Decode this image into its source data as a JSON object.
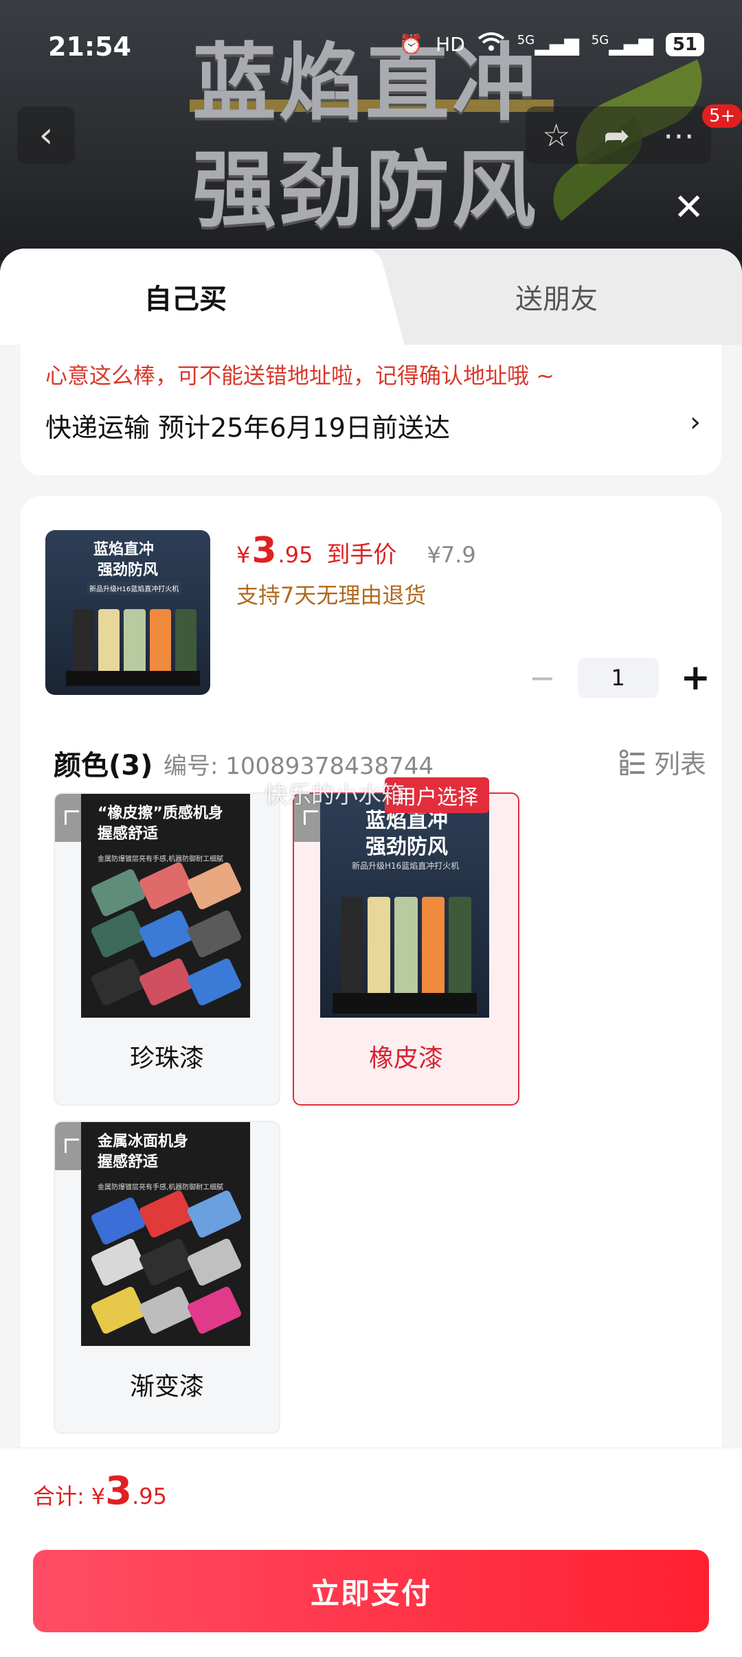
{
  "status_bar": {
    "time": "21:54",
    "hd": "HD",
    "net1": "5G",
    "net2": "5G",
    "battery": "51"
  },
  "banner": {
    "line1": "蓝焰直冲",
    "line2": "强劲防风",
    "badge_count": "5+"
  },
  "icons": {
    "back": "chevron-left-icon",
    "favorite": "star-icon",
    "share": "share-icon",
    "more": "more-icon",
    "close": "close-icon"
  },
  "tabs": {
    "self": "自己买",
    "friend": "送朋友"
  },
  "address": {
    "hint": "心意这么棒，可不能送错地址啦，记得确认地址哦 ~",
    "delivery": "快递运输 预计25年6月19日前送达",
    "arrow": "›"
  },
  "product": {
    "thumb_title1": "蓝焰直冲",
    "thumb_title2": "强劲防风",
    "thumb_sub": "新品升级H16蓝焰直冲打火机",
    "price_currency": "¥",
    "price_int": "3",
    "price_dec": ".95",
    "price_label": "到手价",
    "original_price": "¥7.9",
    "return_policy": "支持7天无理由退货",
    "quantity": "1",
    "minus": "−",
    "plus": "+"
  },
  "spec": {
    "title": "颜色(3)",
    "code": "编号: 10089378438744",
    "list_label": "列表"
  },
  "options": [
    {
      "name": "珍珠漆",
      "head1": "“橡皮擦”质感机身",
      "head2": "握感舒适",
      "sub": "金属防爆镀层亮有手感,机器防御耐工细腻"
    },
    {
      "name": "橡皮漆",
      "head1": "蓝焰直冲",
      "head2": "强劲防风",
      "sub": "新品升级H16蓝焰直冲打火机"
    },
    {
      "name": "渐变漆",
      "head1": "金属冰面机身",
      "head2": "握感舒适",
      "sub": "金属防爆镀层亮有手感,机器防御耐工细腻"
    }
  ],
  "popular_badge": "用户选择",
  "watermark": "快乐的小水箱",
  "footer": {
    "total_label": "合计:",
    "total_currency": "¥",
    "total_int": "3",
    "total_dec": ".95",
    "pay_label": "立即支付"
  },
  "colors": {
    "accent": "#e02020",
    "pay_gradient_start": "#ff4d65",
    "pay_gradient_end": "#ff2030",
    "policy": "#b06a1f"
  }
}
